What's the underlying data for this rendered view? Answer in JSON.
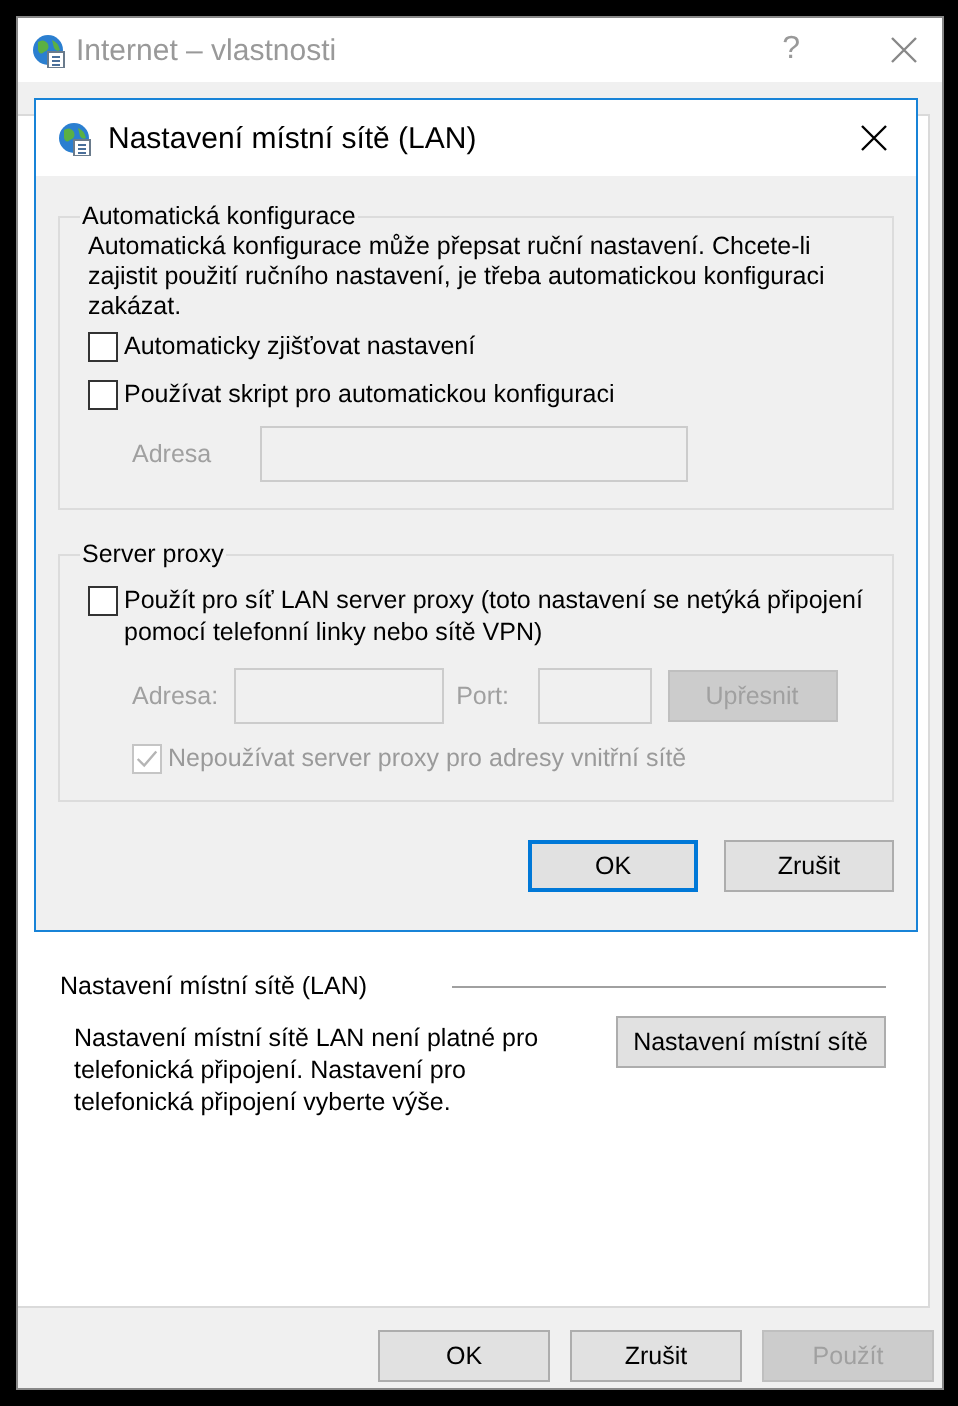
{
  "window": {
    "title": "Internet – vlastnosti",
    "help": "?"
  },
  "lan_section": {
    "heading": "Nastavení místní sítě (LAN)",
    "description": "Nastavení místní sítě LAN není platné pro telefonická připojení. Nastavení pro telefonická připojení vyberte výše.",
    "button": "Nastavení místní sítě"
  },
  "buttons": [
    {
      "label": "OK",
      "disabled": false
    },
    {
      "label": "Zrušit",
      "disabled": false
    },
    {
      "label": "Použít",
      "disabled": true
    }
  ],
  "dialog": {
    "title": "Nastavení místní sítě (LAN)",
    "auto_config": {
      "legend": "Automatická konfigurace",
      "description": "Automatická konfigurace může přepsat ruční nastavení. Chcete-li zajistit použití ručního nastavení, je třeba automatickou konfiguraci zakázat.",
      "options": [
        {
          "label": "Automaticky zjišťovat nastavení",
          "checked": false,
          "disabled": false
        },
        {
          "label": "Používat skript pro automatickou konfiguraci",
          "checked": false,
          "disabled": false
        }
      ],
      "address": {
        "label": "Adresa",
        "disabled": true
      }
    },
    "proxy": {
      "legend": "Server proxy",
      "use_proxy": {
        "label": "Použít pro síť LAN server proxy (toto nastavení se netýká připojení pomocí telefonní linky nebo sítě VPN)",
        "checked": false,
        "disabled": false
      },
      "address": {
        "label": "Adresa:",
        "disabled": true
      },
      "port": {
        "label": "Port:",
        "disabled": true
      },
      "advanced": {
        "label": "Upřesnit",
        "disabled": true
      },
      "bypass": {
        "label": "Nepoužívat server proxy pro adresy vnitřní sítě",
        "checked": true,
        "disabled": true
      }
    },
    "buttons": [
      {
        "label": "OK",
        "default": true
      },
      {
        "label": "Zrušit",
        "default": false
      }
    ]
  }
}
